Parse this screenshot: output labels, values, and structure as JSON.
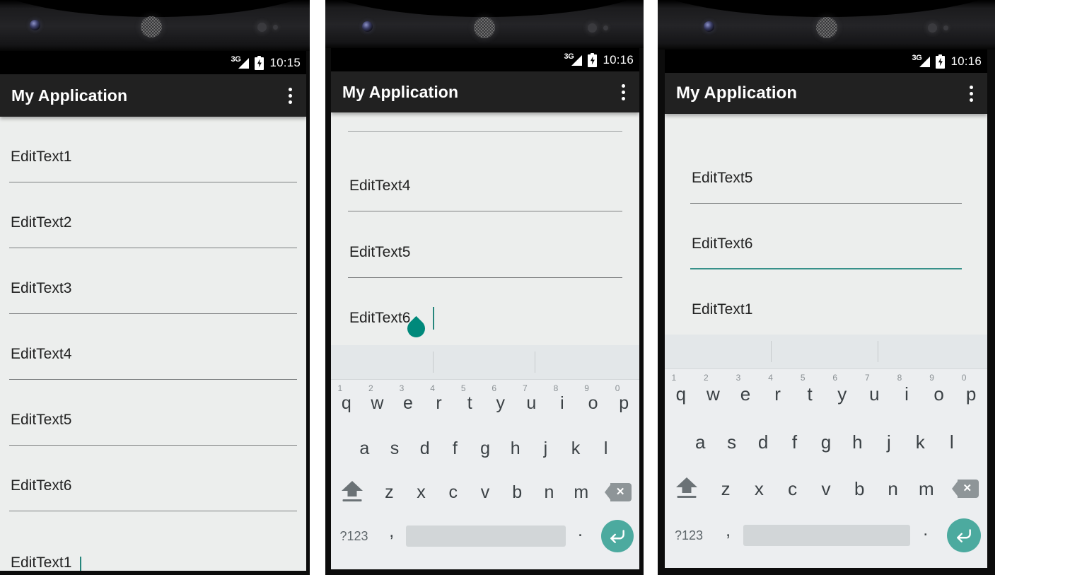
{
  "app": {
    "title": "My Application",
    "accent_color": "#4caa9f",
    "focus_underline_color": "#38918a",
    "actionbar_color": "#212121",
    "screen_background": "#eceeed",
    "keyboard_background": "#eceef0"
  },
  "panels": [
    {
      "name": "panel-1-full-list",
      "status": {
        "network": "3G",
        "battery": "charging",
        "time": "10:15"
      },
      "fields": [
        {
          "label": "EditText1",
          "focused": false
        },
        {
          "label": "EditText2",
          "focused": false
        },
        {
          "label": "EditText3",
          "focused": false
        },
        {
          "label": "EditText4",
          "focused": false
        },
        {
          "label": "EditText5",
          "focused": false
        },
        {
          "label": "EditText6",
          "focused": false
        }
      ],
      "clipped_field": {
        "label": "EditText1",
        "focused": true
      },
      "keyboard_visible": false
    },
    {
      "name": "panel-2-keyboard-edittext6",
      "status": {
        "network": "3G",
        "battery": "charging",
        "time": "10:16"
      },
      "scrolled_top_rule": true,
      "fields": [
        {
          "label": "EditText4",
          "focused": false
        },
        {
          "label": "EditText5",
          "focused": false
        },
        {
          "label": "EditText6",
          "focused": true,
          "caret": true,
          "handle": true
        }
      ],
      "keyboard_visible": true
    },
    {
      "name": "panel-3-keyboard-edittext1",
      "status": {
        "network": "3G",
        "battery": "charging",
        "time": "10:16"
      },
      "scrolled_top_rule": false,
      "fields": [
        {
          "label": "EditText5",
          "focused": false
        },
        {
          "label": "EditText6",
          "focused": true
        },
        {
          "label": "EditText1",
          "focused": false,
          "no_underline": true
        }
      ],
      "keyboard_visible": true
    }
  ],
  "keyboard": {
    "suggestion_strip": {
      "suggestions": [],
      "dividers": 2
    },
    "row1": [
      {
        "key": "q",
        "num": "1"
      },
      {
        "key": "w",
        "num": "2"
      },
      {
        "key": "e",
        "num": "3"
      },
      {
        "key": "r",
        "num": "4"
      },
      {
        "key": "t",
        "num": "5"
      },
      {
        "key": "y",
        "num": "6"
      },
      {
        "key": "u",
        "num": "7"
      },
      {
        "key": "i",
        "num": "8"
      },
      {
        "key": "o",
        "num": "9"
      },
      {
        "key": "p",
        "num": "0"
      }
    ],
    "row2": [
      {
        "key": "a"
      },
      {
        "key": "s"
      },
      {
        "key": "d"
      },
      {
        "key": "f"
      },
      {
        "key": "g"
      },
      {
        "key": "h"
      },
      {
        "key": "j"
      },
      {
        "key": "k"
      },
      {
        "key": "l"
      }
    ],
    "row3": [
      {
        "key": "z"
      },
      {
        "key": "x"
      },
      {
        "key": "c"
      },
      {
        "key": "v"
      },
      {
        "key": "b"
      },
      {
        "key": "n"
      },
      {
        "key": "m"
      }
    ],
    "shift_label": "shift",
    "delete_label": "delete",
    "symbols_label": "?123",
    "comma_label": ",",
    "space_label": "",
    "period_label": ".",
    "enter_label": "enter"
  }
}
